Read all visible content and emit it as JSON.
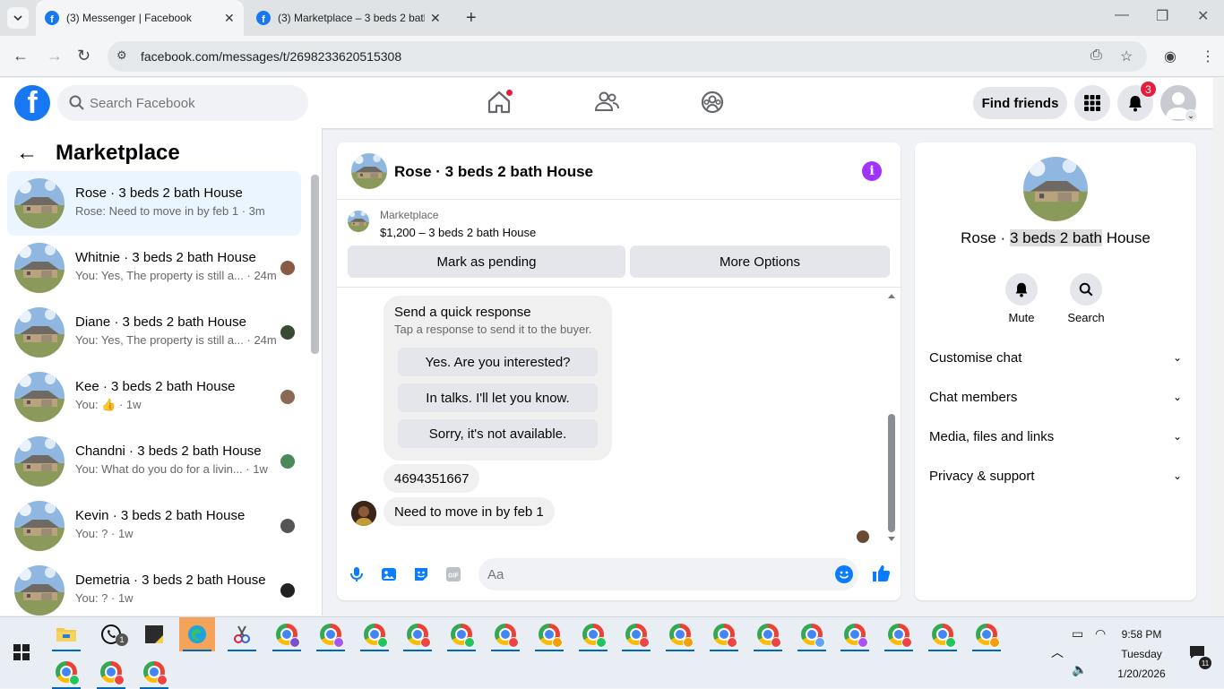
{
  "browser": {
    "tabs": [
      {
        "title": "(3) Messenger | Facebook",
        "active": true
      },
      {
        "title": "(3) Marketplace – 3 beds 2 bath",
        "active": false
      }
    ],
    "url": "facebook.com/messages/t/2698233620515308"
  },
  "header": {
    "search_placeholder": "Search Facebook",
    "find_friends": "Find friends",
    "notification_count": "3",
    "icons": [
      "home-icon",
      "friends-icon",
      "groups-icon",
      "menu-grid-icon",
      "bell-icon"
    ]
  },
  "sidebar": {
    "title": "Marketplace",
    "conversations": [
      {
        "name": "Rose · 3 beds 2 bath House",
        "preview": "Rose: Need to move in by feb 1 · 3m",
        "selected": true
      },
      {
        "name": "Whitnie · 3 beds 2 bath House",
        "preview": "You: Yes, The property is still a... · 24m",
        "selected": false
      },
      {
        "name": "Diane · 3 beds 2 bath House",
        "preview": "You: Yes, The property is still a... · 24m",
        "selected": false
      },
      {
        "name": "Kee · 3 beds 2 bath House",
        "preview": "You: 👍 · 1w",
        "selected": false
      },
      {
        "name": "Chandni · 3 beds 2 bath House",
        "preview": "You: What do you do for a livin... · 1w",
        "selected": false
      },
      {
        "name": "Kevin · 3 beds 2 bath House",
        "preview": "You: ? · 1w",
        "selected": false
      },
      {
        "name": "Demetria · 3 beds 2 bath House",
        "preview": "You: ? · 1w",
        "selected": false
      }
    ]
  },
  "chat": {
    "title": "Rose · 3 beds 2 bath House",
    "listing_label": "Marketplace",
    "listing_price": "$1,200 – 3 beds 2 bath House",
    "mark_pending": "Mark as pending",
    "more_options": "More Options",
    "quick_response": {
      "title": "Send a quick response",
      "subtitle": "Tap a response to send it to the buyer.",
      "options": [
        "Yes. Are you interested?",
        "In talks. I'll let you know.",
        "Sorry, it's not available."
      ]
    },
    "messages": [
      "4694351667",
      "Need to move in by feb 1"
    ],
    "composer_placeholder": "Aa"
  },
  "details": {
    "name_prefix": "Rose · ",
    "name_highlight": "3 beds 2 bath",
    "name_suffix": " House",
    "actions": [
      {
        "label": "Mute",
        "icon": "bell-icon"
      },
      {
        "label": "Search",
        "icon": "search-icon"
      }
    ],
    "sections": [
      "Customise chat",
      "Chat members",
      "Media, files and links",
      "Privacy & support"
    ]
  },
  "taskbar": {
    "time": "9:58 PM",
    "day": "Tuesday",
    "date": "1/20/2026",
    "whatsapp_badge": "1",
    "notif_badge": "11"
  },
  "colors": {
    "fb_blue": "#1877f2",
    "messenger_blue": "#0a7cff",
    "info_purple": "#a033ff",
    "badge_red": "#e41e3f"
  }
}
